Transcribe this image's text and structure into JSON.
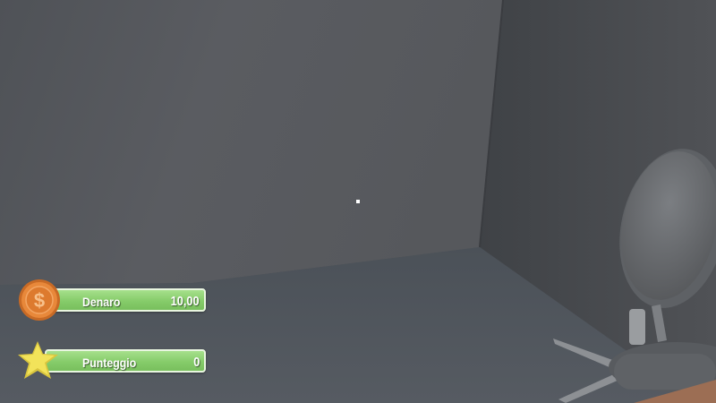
{
  "hud": {
    "money": {
      "label": "Denaro",
      "value": "10,00",
      "icon": "coin-dollar-icon"
    },
    "score": {
      "label": "Punteggio",
      "value": "0",
      "icon": "star-icon"
    }
  },
  "colors": {
    "hud_bar": "#86cc6a",
    "hud_border": "#e9f6e0",
    "coin": "#e8883a",
    "star": "#f2e35a"
  }
}
